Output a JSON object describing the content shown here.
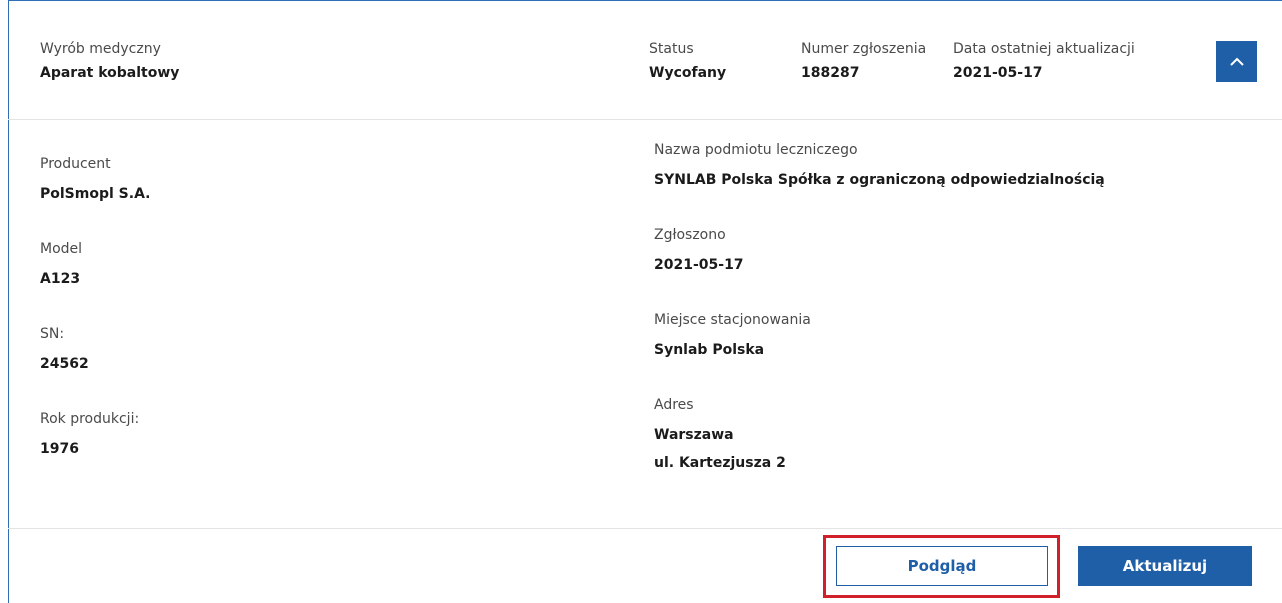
{
  "header": {
    "device_label": "Wyrób medyczny",
    "device_value": "Aparat kobaltowy",
    "status_label": "Status",
    "status_value": "Wycofany",
    "number_label": "Numer zgłoszenia",
    "number_value": "188287",
    "updated_label": "Data ostatniej aktualizacji",
    "updated_value": "2021-05-17",
    "collapse_icon": "chevron-up-icon"
  },
  "details_left": [
    {
      "label": "Producent",
      "value": "PolSmopl S.A."
    },
    {
      "label": "Model",
      "value": "A123"
    },
    {
      "label": "SN:",
      "value": "24562"
    },
    {
      "label": "Rok produkcji:",
      "value": "1976"
    }
  ],
  "details_right": {
    "facility_label": "Nazwa podmiotu leczniczego",
    "facility_value": "SYNLAB Polska Spółka z ograniczoną odpowiedzialnością",
    "reported_label": "Zgłoszono",
    "reported_value": "2021-05-17",
    "location_label": "Miejsce stacjonowania",
    "location_value": "Synlab Polska",
    "address_label": "Adres",
    "address_line1": "Warszawa",
    "address_line2": "ul. Kartezjusza 2"
  },
  "actions": {
    "preview_label": "Podgląd",
    "update_label": "Aktualizuj"
  },
  "colors": {
    "primary": "#1f5fa8",
    "highlight": "#d0202a"
  }
}
